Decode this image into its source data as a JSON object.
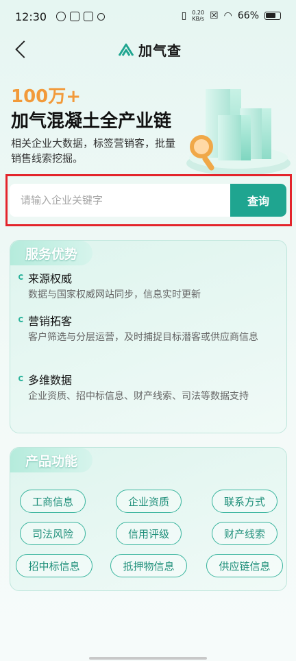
{
  "status": {
    "time": "12:30",
    "net_speed_value": "0.20",
    "net_speed_unit": "KB/s",
    "battery": "66%"
  },
  "nav": {
    "brand": "加气查"
  },
  "hero": {
    "highlight": "100万+",
    "title": "加气混凝土全产业链",
    "subtitle": "相关企业大数据，标签营销客，批量销售线索挖掘。"
  },
  "search": {
    "placeholder": "请输入企业关键字",
    "button": "查询"
  },
  "advantages": {
    "title": "服务优势",
    "items": [
      {
        "title": "来源权威",
        "desc": "数据与国家权威网站同步，信息实时更新"
      },
      {
        "title": "营销拓客",
        "desc": "客户筛选与分层运营，及时捕捉目标潜客或供应商信息"
      },
      {
        "title": "多维数据",
        "desc": "企业资质、招中标信息、财产线索、司法等数据支持"
      }
    ]
  },
  "features": {
    "title": "产品功能",
    "chips": [
      "工商信息",
      "企业资质",
      "联系方式",
      "司法风险",
      "信用评级",
      "财产线索",
      "招中标信息",
      "抵押物信息",
      "供应链信息"
    ]
  },
  "colors": {
    "accent": "#1fa590",
    "highlight_text": "#f29a3a",
    "highlight_border": "#e3242b"
  }
}
